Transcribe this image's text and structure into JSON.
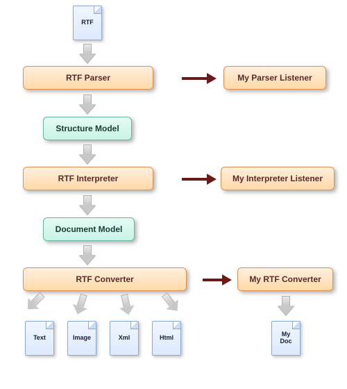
{
  "input_file": {
    "label": "RTF"
  },
  "processes": {
    "parser": {
      "label": "RTF Parser"
    },
    "interpreter": {
      "label": "RTF Interpreter"
    },
    "converter": {
      "label": "RTF Converter"
    }
  },
  "models": {
    "structure": {
      "label": "Structure Model"
    },
    "document": {
      "label": "Document Model"
    }
  },
  "listeners": {
    "parser": {
      "label": "My Parser Listener"
    },
    "interpreter": {
      "label": "My Interpreter Listener"
    },
    "converter": {
      "label": "My RTF Converter"
    }
  },
  "outputs": {
    "text": {
      "label": "Text"
    },
    "image": {
      "label": "Image"
    },
    "xml": {
      "label": "Xml"
    },
    "html": {
      "label": "Html"
    },
    "mydoc": {
      "label": "My\nDoc"
    }
  }
}
